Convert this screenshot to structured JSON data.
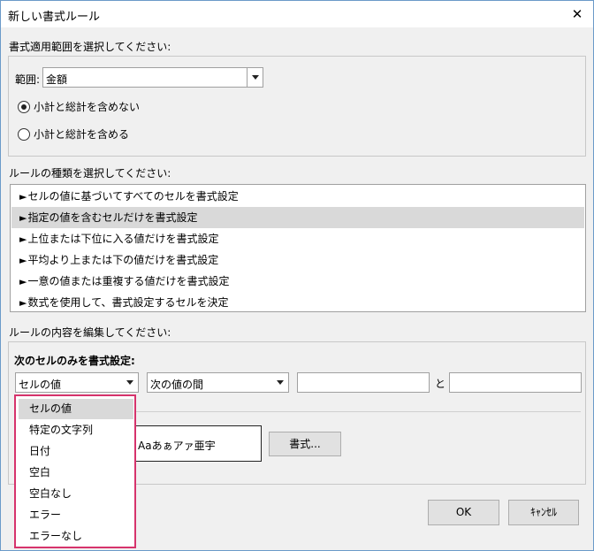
{
  "window": {
    "title": "新しい書式ルール"
  },
  "scope": {
    "section_label": "書式適用範囲を選択してください:",
    "range_label": "範囲:",
    "range_value": "金額",
    "radio_options": [
      {
        "label": "小計と総計を含めない",
        "checked": true
      },
      {
        "label": "小計と総計を含める",
        "checked": false
      }
    ]
  },
  "rule_types": {
    "section_label": "ルールの種類を選択してください:",
    "bullet": "►",
    "items": [
      {
        "label": "セルの値に基づいてすべてのセルを書式設定",
        "selected": false
      },
      {
        "label": "指定の値を含むセルだけを書式設定",
        "selected": true
      },
      {
        "label": "上位または下位に入る値だけを書式設定",
        "selected": false
      },
      {
        "label": "平均より上または下の値だけを書式設定",
        "selected": false
      },
      {
        "label": "一意の値または重複する値だけを書式設定",
        "selected": false
      },
      {
        "label": "数式を使用して、書式設定するセルを決定",
        "selected": false
      }
    ]
  },
  "rule_edit": {
    "section_label": "ルールの内容を編集してください:",
    "condition_label": "次のセルのみを書式設定:",
    "field_select_value": "セルの値",
    "operator_select_value": "次の値の間",
    "value1": "",
    "and_label": "と",
    "value2": "",
    "preview_text": "Aaあぁアァ亜宇",
    "format_button": "書式..."
  },
  "dropdown": {
    "options": [
      {
        "label": "セルの値",
        "selected": true
      },
      {
        "label": "特定の文字列",
        "selected": false
      },
      {
        "label": "日付",
        "selected": false
      },
      {
        "label": "空白",
        "selected": false
      },
      {
        "label": "空白なし",
        "selected": false
      },
      {
        "label": "エラー",
        "selected": false
      },
      {
        "label": "エラーなし",
        "selected": false
      }
    ],
    "highlight_color": "#d6336c"
  },
  "footer": {
    "ok_label": "OK",
    "cancel_label": "ｷｬﾝｾﾙ"
  }
}
